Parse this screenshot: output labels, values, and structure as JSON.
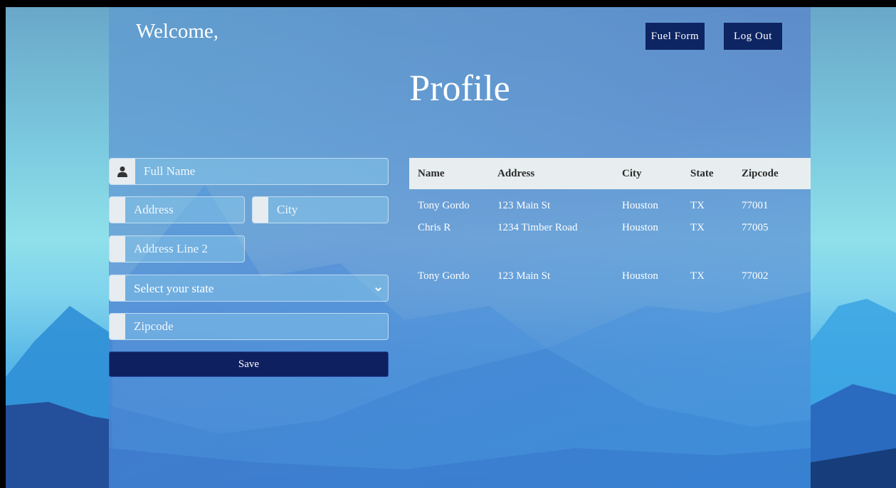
{
  "header": {
    "welcome": "Welcome,",
    "nav": {
      "fuel_form": "Fuel Form",
      "log_out": "Log Out"
    }
  },
  "page_title": "Profile",
  "form": {
    "full_name_placeholder": "Full Name",
    "address_placeholder": "Address",
    "city_placeholder": "City",
    "address2_placeholder": "Address Line 2",
    "state_selected": "Select your state",
    "zipcode_placeholder": "Zipcode",
    "save_label": "Save"
  },
  "table": {
    "headers": [
      "Name",
      "Address",
      "City",
      "State",
      "Zipcode"
    ],
    "rows": [
      [
        "Tony Gordo",
        "123 Main St",
        "Houston",
        "TX",
        "77001"
      ],
      [
        "Chris R",
        "1234 Timber Road",
        "Houston",
        "TX",
        "77005"
      ],
      [
        "Tony Gordo",
        "123 Main St",
        "Houston",
        "TX",
        "77002"
      ]
    ]
  },
  "colors": {
    "accent": "#0e2563",
    "header_row": "#e8eeef"
  },
  "icons": {
    "user": "user-icon",
    "dropdown": "chevron-down-icon"
  }
}
